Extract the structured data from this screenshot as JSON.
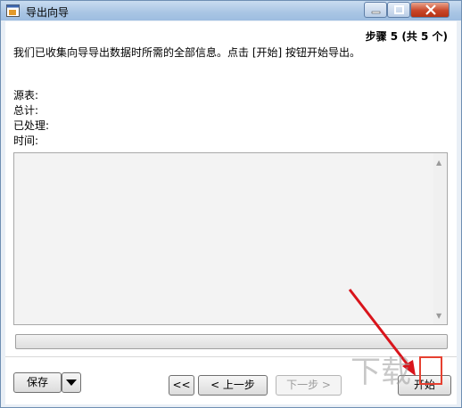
{
  "window": {
    "title": "导出向导",
    "icon": "export-wizard-icon"
  },
  "colors": {
    "titlebar": "#a9c5e4",
    "close_button": "#c9472a",
    "annotation_arrow": "#d9141b"
  },
  "header": {
    "step_label": "步骤 5 (共 5 个)"
  },
  "intro_text": "我们已收集向导导出数据时所需的全部信息。点击 [开始] 按钮开始导出。",
  "stats": {
    "source_table_label": "源表:",
    "total_label": "总计:",
    "processed_label": "已处理:",
    "time_label": "时间:"
  },
  "log": {
    "content": ""
  },
  "progress": {
    "value": 0
  },
  "footer": {
    "save_label": "保存",
    "first_label": "<<",
    "prev_label": "< 上一步",
    "next_label": "下一步 >",
    "start_label": "开始"
  },
  "watermark": {
    "text": "下载"
  }
}
